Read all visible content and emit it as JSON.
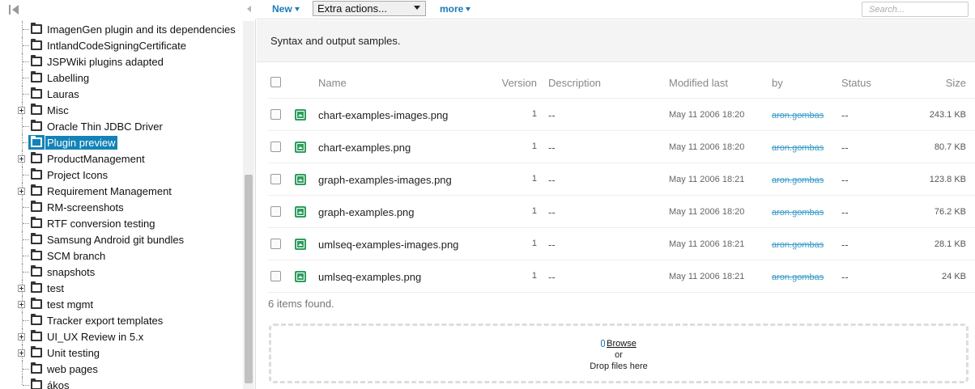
{
  "tree": {
    "items": [
      {
        "label": "ImagenGen plugin and its dependencies",
        "expandable": false,
        "selected": false
      },
      {
        "label": "IntlandCodeSigningCertificate",
        "expandable": false,
        "selected": false
      },
      {
        "label": "JSPWiki plugins adapted",
        "expandable": false,
        "selected": false
      },
      {
        "label": "Labelling",
        "expandable": false,
        "selected": false
      },
      {
        "label": "Lauras",
        "expandable": false,
        "selected": false
      },
      {
        "label": "Misc",
        "expandable": true,
        "selected": false
      },
      {
        "label": "Oracle Thin JDBC Driver",
        "expandable": false,
        "selected": false
      },
      {
        "label": "Plugin preview",
        "expandable": false,
        "selected": true
      },
      {
        "label": "ProductManagement",
        "expandable": true,
        "selected": false
      },
      {
        "label": "Project Icons",
        "expandable": false,
        "selected": false
      },
      {
        "label": "Requirement Management",
        "expandable": true,
        "selected": false
      },
      {
        "label": "RM-screenshots",
        "expandable": false,
        "selected": false
      },
      {
        "label": "RTF conversion testing",
        "expandable": false,
        "selected": false
      },
      {
        "label": "Samsung Android git bundles",
        "expandable": false,
        "selected": false
      },
      {
        "label": "SCM branch",
        "expandable": false,
        "selected": false
      },
      {
        "label": "snapshots",
        "expandable": false,
        "selected": false
      },
      {
        "label": "test",
        "expandable": true,
        "selected": false
      },
      {
        "label": "test mgmt",
        "expandable": true,
        "selected": false
      },
      {
        "label": "Tracker export templates",
        "expandable": false,
        "selected": false
      },
      {
        "label": "UI_UX Review in 5.x",
        "expandable": true,
        "selected": false
      },
      {
        "label": "Unit testing",
        "expandable": true,
        "selected": false
      },
      {
        "label": "web pages",
        "expandable": false,
        "selected": false
      },
      {
        "label": "ákos",
        "expandable": false,
        "selected": false
      }
    ]
  },
  "toolbar": {
    "new_label": "New",
    "extra_actions_label": "Extra actions...",
    "more_label": "more",
    "search_placeholder": "Search..."
  },
  "description": "Syntax and output samples.",
  "table": {
    "headers": {
      "name": "Name",
      "version": "Version",
      "description": "Description",
      "modified": "Modified last",
      "by": "by",
      "status": "Status",
      "size": "Size"
    },
    "rows": [
      {
        "name": "chart-examples-images.png",
        "version": "1",
        "description": "--",
        "modified": "May 11 2006 18:20",
        "by": "aron.gombas",
        "status": "--",
        "size": "243.1 KB"
      },
      {
        "name": "chart-examples.png",
        "version": "1",
        "description": "--",
        "modified": "May 11 2006 18:20",
        "by": "aron.gombas",
        "status": "--",
        "size": "80.7 KB"
      },
      {
        "name": "graph-examples-images.png",
        "version": "1",
        "description": "--",
        "modified": "May 11 2006 18:21",
        "by": "aron.gombas",
        "status": "--",
        "size": "123.8 KB"
      },
      {
        "name": "graph-examples.png",
        "version": "1",
        "description": "--",
        "modified": "May 11 2006 18:20",
        "by": "aron.gombas",
        "status": "--",
        "size": "76.2 KB"
      },
      {
        "name": "umlseq-examples-images.png",
        "version": "1",
        "description": "--",
        "modified": "May 11 2006 18:21",
        "by": "aron.gombas",
        "status": "--",
        "size": "28.1 KB"
      },
      {
        "name": "umlseq-examples.png",
        "version": "1",
        "description": "--",
        "modified": "May 11 2006 18:21",
        "by": "aron.gombas",
        "status": "--",
        "size": "24 KB"
      }
    ],
    "found_text": "6 items found."
  },
  "dropzone": {
    "browse_label": "Browse",
    "or_label": "or",
    "drop_label": "Drop files here"
  },
  "colors": {
    "selected_bg": "#1383b7",
    "link": "#1a7bb9",
    "image_icon": "#2e9e5e"
  }
}
